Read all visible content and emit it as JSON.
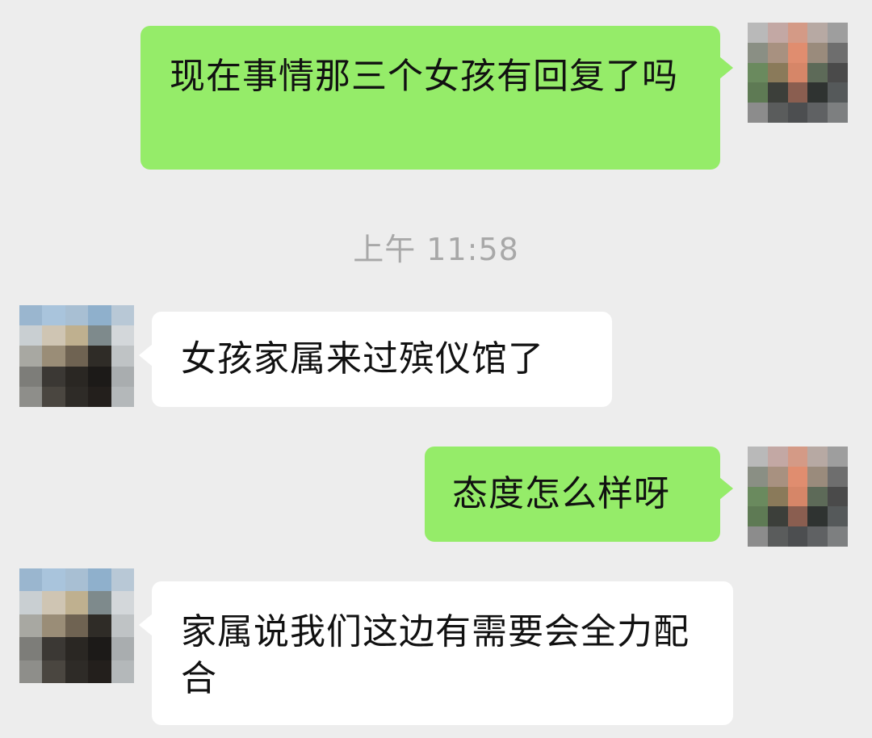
{
  "conversation": {
    "messages": [
      {
        "sender": "self",
        "text": "现在事情那三个女孩有回复了吗"
      },
      {
        "sender": "other",
        "text": "女孩家属来过殡仪馆了"
      },
      {
        "sender": "self",
        "text": "态度怎么样呀"
      },
      {
        "sender": "other",
        "text": "家属说我们这边有需要会全力配合"
      }
    ],
    "timestamp": "上午 11:58"
  },
  "colors": {
    "background": "#ededed",
    "self_bubble": "#95ec69",
    "other_bubble": "#ffffff",
    "timestamp_text": "#a8a8a8"
  },
  "avatars": {
    "self": "pixelated-avatar",
    "other": "pixelated-avatar"
  }
}
